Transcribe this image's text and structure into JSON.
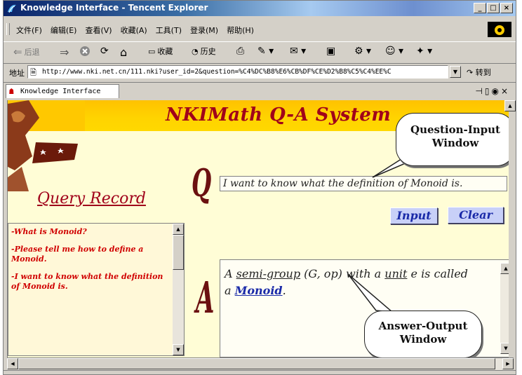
{
  "window": {
    "title": "Knowledge Interface - Tencent Explorer"
  },
  "menu": [
    "文件(F)",
    "编辑(E)",
    "查看(V)",
    "收藏(A)",
    "工具(T)",
    "登录(M)",
    "帮助(H)"
  ],
  "toolbar": {
    "back_label": "后退",
    "favorites_label": "收藏",
    "history_label": "历史"
  },
  "address": {
    "label": "地址",
    "url": "http://www.nki.net.cn/111.nki?user_id=2&question=%C4%DC%B8%E6%CB%DF%CE%D2%B8%C5%C4%EE%C",
    "go_label": "转到"
  },
  "tab": {
    "label": "Knowledge Interface"
  },
  "page": {
    "banner_title": "NKIMath Q-A System",
    "query_title": "Query Record",
    "query_items": [
      "-What is Monoid?",
      "-Please tell me how to define a Monoid.",
      "-I want to know what the definition of Monoid is."
    ],
    "q_letter": "Q",
    "a_letter": "A",
    "question_value": "I want to know what the definition of Monoid is.",
    "input_button": "Input",
    "clear_button": "Clear",
    "answer": {
      "part1": "A ",
      "semi_group": "semi-group",
      "part2": " (G, op) with a ",
      "unit": "unit",
      "part3": " e is called",
      "part4": "a ",
      "monoid": "Monoid",
      "part5": "."
    },
    "callout_question": "Question-Input Window",
    "callout_answer": "Answer-Output Window"
  },
  "colors": {
    "banner": "#ffc800",
    "title_red": "#a0001a",
    "button_blue": "#1a2aa8"
  }
}
